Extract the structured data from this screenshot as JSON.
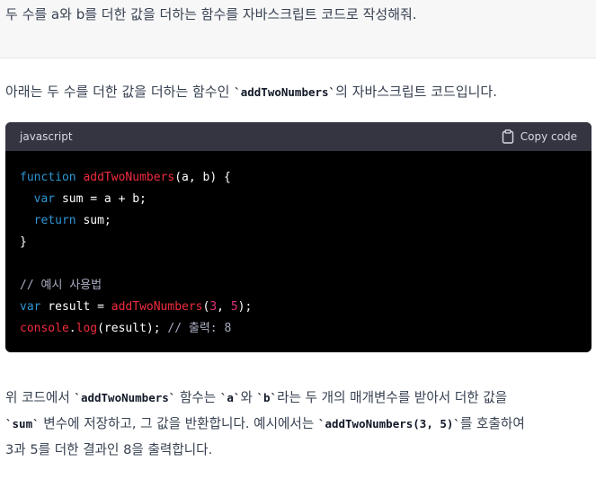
{
  "user_message": "두 수를 a와 b를 더한 값을 더하는 함수를 자바스크립트 코드로 작성해줘.",
  "intro": {
    "before": "아래는 두 수를 더한 값을 더하는 함수인 ",
    "code": "`addTwoNumbers`",
    "after": "의 자바스크립트 코드입니다."
  },
  "code_block": {
    "language": "javascript",
    "copy_label": "Copy code",
    "tokens": {
      "function_kw": "function",
      "fn_name": "addTwoNumbers",
      "params": "(a, b) {",
      "var_kw": "var",
      "sum_expr": " sum = a + b;",
      "return_kw": "return",
      "return_val": " sum;",
      "close_brace": "}",
      "comment1": "// 예시 사용법",
      "var_kw2": "var",
      "result_assign": " result = ",
      "call_fn": "addTwoNumbers",
      "call_open": "(",
      "arg1": "3",
      "arg_sep": ", ",
      "arg2": "5",
      "call_close": ");",
      "console": "console",
      "dot": ".",
      "log": "log",
      "log_args": "(result); ",
      "comment2": "// 출력: 8"
    }
  },
  "outro": {
    "l1_a": "위 코드에서 ",
    "l1_code1": "`addTwoNumbers`",
    "l1_b": " 함수는 ",
    "l1_code2": "`a`",
    "l1_c": "와 ",
    "l1_code3": "`b`",
    "l1_d": "라는 두 개의 매개변수를 받아서 더한 값을",
    "l2_code1": "`sum`",
    "l2_a": " 변수에 저장하고, 그 값을 반환합니다. 예시에서는 ",
    "l2_code2": "`addTwoNumbers(3, 5)`",
    "l2_b": "를 호출하여",
    "l3": "3과 5를 더한 결과인 8을 출력합니다."
  }
}
